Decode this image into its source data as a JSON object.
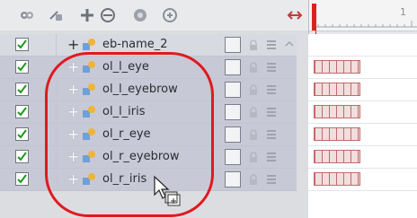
{
  "toolbar": {
    "icons": [
      "show-hide-icon",
      "lock-icon",
      "add-layer-icon",
      "remove-layer-icon",
      "color-icon",
      "extra-icon"
    ]
  },
  "timeline": {
    "frame_number_partial": "1"
  },
  "layers": [
    {
      "name": "eb-name_2",
      "visible": true,
      "selected": false
    },
    {
      "name": "ol_l_eye",
      "visible": true,
      "selected": true
    },
    {
      "name": "ol_l_eyebrow",
      "visible": true,
      "selected": true
    },
    {
      "name": "ol_l_iris",
      "visible": true,
      "selected": true
    },
    {
      "name": "ol_r_eye",
      "visible": true,
      "selected": true
    },
    {
      "name": "ol_r_eyebrow",
      "visible": true,
      "selected": true
    },
    {
      "name": "ol_r_iris",
      "visible": true,
      "selected": true
    }
  ],
  "colors": {
    "highlight": "#e1191e",
    "playhead": "#e02020",
    "selected_row": "#c7c9d6"
  }
}
